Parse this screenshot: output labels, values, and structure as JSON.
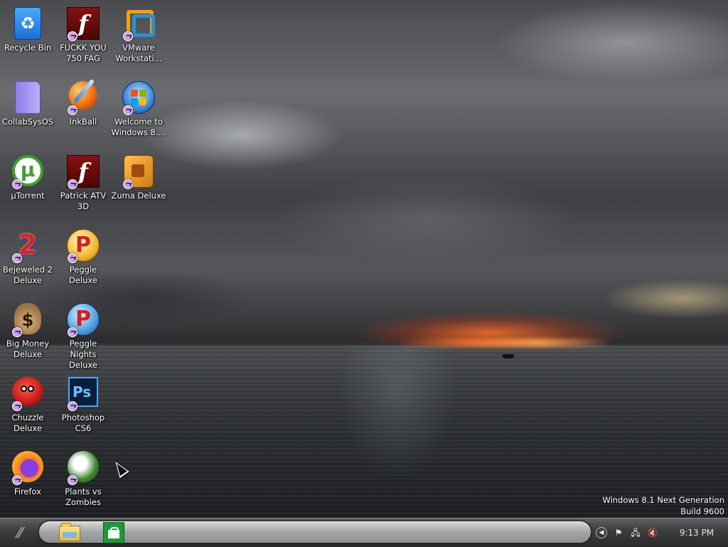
{
  "desktop": {
    "icons": [
      {
        "label": "Recycle Bin",
        "icon": "recycle-bin-icon"
      },
      {
        "label": "FUCKK YOU\n750 FAG",
        "icon": "flash-icon"
      },
      {
        "label": "VMware\nWorkstati...",
        "icon": "vmware-icon"
      },
      {
        "label": "CollabSysOS",
        "icon": "folder-icon"
      },
      {
        "label": "InkBall",
        "icon": "inkball-icon"
      },
      {
        "label": "Welcome to\nWindows 8....",
        "icon": "windows-logo-icon"
      },
      {
        "label": "µTorrent",
        "icon": "utorrent-icon"
      },
      {
        "label": "Patrick ATV\n3D",
        "icon": "flash-icon"
      },
      {
        "label": "Zuma Deluxe",
        "icon": "zuma-icon"
      },
      {
        "label": "Bejeweled 2\nDeluxe",
        "icon": "bejeweled-icon"
      },
      {
        "label": "Peggle Deluxe",
        "icon": "peggle-icon"
      },
      {
        "label": "Big Money\nDeluxe",
        "icon": "money-bag-icon"
      },
      {
        "label": "Peggle Nights\nDeluxe",
        "icon": "peggle-nights-icon"
      },
      {
        "label": "Chuzzle\nDeluxe",
        "icon": "chuzzle-icon"
      },
      {
        "label": "Photoshop\nCS6",
        "icon": "photoshop-icon"
      },
      {
        "label": "Firefox",
        "icon": "firefox-icon"
      },
      {
        "label": "Plants vs\nZombies",
        "icon": "plants-vs-zombies-icon"
      }
    ],
    "watermark": {
      "line1": "Windows 8.1 Next Generation",
      "line2": "Build 9600"
    }
  },
  "taskbar": {
    "start_glyph": "⁄⁄",
    "pinned": [
      {
        "name": "File Explorer",
        "icon": "file-explorer-icon"
      },
      {
        "name": "Store",
        "icon": "store-icon"
      }
    ],
    "tray": {
      "expand_glyph": "◀",
      "flag_glyph": "⚑",
      "network_glyph": "🖧",
      "volume_glyph": "🔇",
      "time": "9:13 PM"
    }
  }
}
